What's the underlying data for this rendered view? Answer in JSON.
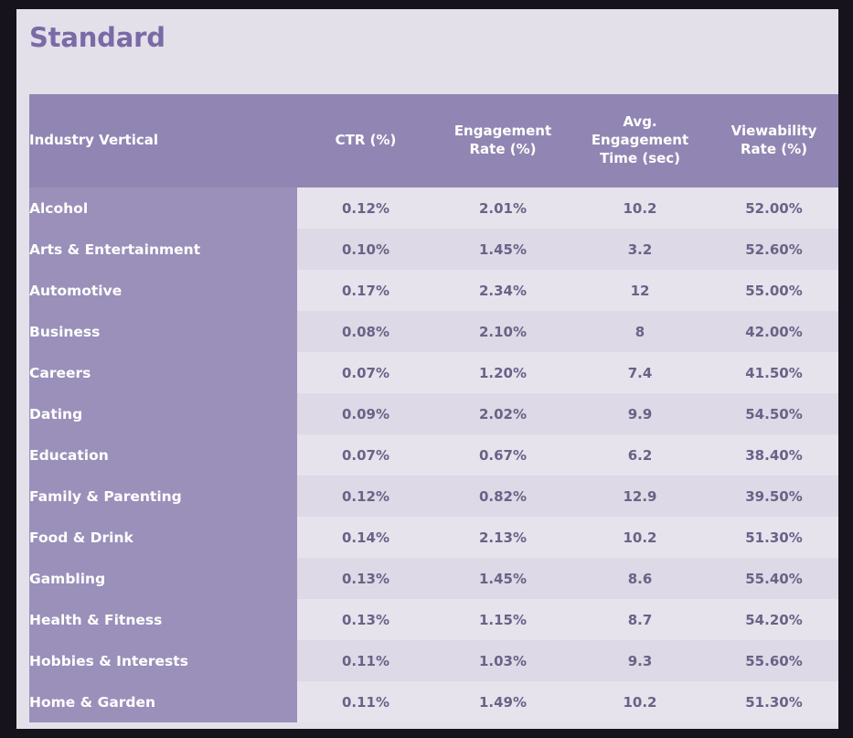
{
  "page": {
    "title": "Standard",
    "panel_color": "#E3E0EA",
    "frame_color": "#17131D",
    "title_color": "#7A6BA6",
    "header_color": "#9186B3",
    "first_column_color": "#9A90BA",
    "row_odd_color": "#E6E3ED",
    "row_even_color": "#DDD9E6",
    "data_text_color": "#6B6287"
  },
  "table": {
    "columns": [
      "Industry Vertical",
      "CTR (%)",
      "Engagement Rate (%)",
      "Avg. Engagement Time (sec)",
      "Viewability Rate (%)"
    ],
    "column_lines": {
      "ctr": [
        "CTR (%)"
      ],
      "engagement_rate": [
        "Engagement",
        "Rate (%)"
      ],
      "avg_engagement_time": [
        "Avg.",
        "Engagement",
        "Time (sec)"
      ],
      "viewability_rate": [
        "Viewability",
        "Rate (%)"
      ]
    },
    "rows": [
      {
        "vertical": "Alcohol",
        "ctr": "0.12%",
        "engagement_rate": "2.01%",
        "avg_engagement_time": "10.2",
        "viewability_rate": "52.00%"
      },
      {
        "vertical": "Arts & Entertainment",
        "ctr": "0.10%",
        "engagement_rate": "1.45%",
        "avg_engagement_time": "3.2",
        "viewability_rate": "52.60%"
      },
      {
        "vertical": "Automotive",
        "ctr": "0.17%",
        "engagement_rate": "2.34%",
        "avg_engagement_time": "12",
        "viewability_rate": "55.00%"
      },
      {
        "vertical": "Business",
        "ctr": "0.08%",
        "engagement_rate": "2.10%",
        "avg_engagement_time": "8",
        "viewability_rate": "42.00%"
      },
      {
        "vertical": "Careers",
        "ctr": "0.07%",
        "engagement_rate": "1.20%",
        "avg_engagement_time": "7.4",
        "viewability_rate": "41.50%"
      },
      {
        "vertical": "Dating",
        "ctr": "0.09%",
        "engagement_rate": "2.02%",
        "avg_engagement_time": "9.9",
        "viewability_rate": "54.50%"
      },
      {
        "vertical": "Education",
        "ctr": "0.07%",
        "engagement_rate": "0.67%",
        "avg_engagement_time": "6.2",
        "viewability_rate": "38.40%"
      },
      {
        "vertical": "Family & Parenting",
        "ctr": "0.12%",
        "engagement_rate": "0.82%",
        "avg_engagement_time": "12.9",
        "viewability_rate": "39.50%"
      },
      {
        "vertical": "Food & Drink",
        "ctr": "0.14%",
        "engagement_rate": "2.13%",
        "avg_engagement_time": "10.2",
        "viewability_rate": "51.30%"
      },
      {
        "vertical": "Gambling",
        "ctr": "0.13%",
        "engagement_rate": "1.45%",
        "avg_engagement_time": "8.6",
        "viewability_rate": "55.40%"
      },
      {
        "vertical": "Health & Fitness",
        "ctr": "0.13%",
        "engagement_rate": "1.15%",
        "avg_engagement_time": "8.7",
        "viewability_rate": "54.20%"
      },
      {
        "vertical": "Hobbies & Interests",
        "ctr": "0.11%",
        "engagement_rate": "1.03%",
        "avg_engagement_time": "9.3",
        "viewability_rate": "55.60%"
      },
      {
        "vertical": "Home & Garden",
        "ctr": "0.11%",
        "engagement_rate": "1.49%",
        "avg_engagement_time": "10.2",
        "viewability_rate": "51.30%"
      }
    ]
  },
  "chart_data": {
    "type": "table",
    "title": "Standard",
    "columns": [
      "Industry Vertical",
      "CTR (%)",
      "Engagement Rate (%)",
      "Avg. Engagement Time (sec)",
      "Viewability Rate (%)"
    ],
    "categories": [
      "Alcohol",
      "Arts & Entertainment",
      "Automotive",
      "Business",
      "Careers",
      "Dating",
      "Education",
      "Family & Parenting",
      "Food & Drink",
      "Gambling",
      "Health & Fitness",
      "Hobbies & Interests",
      "Home & Garden"
    ],
    "series": [
      {
        "name": "CTR (%)",
        "values": [
          0.12,
          0.1,
          0.17,
          0.08,
          0.07,
          0.09,
          0.07,
          0.12,
          0.14,
          0.13,
          0.13,
          0.11,
          0.11
        ]
      },
      {
        "name": "Engagement Rate (%)",
        "values": [
          2.01,
          1.45,
          2.34,
          2.1,
          1.2,
          2.02,
          0.67,
          0.82,
          2.13,
          1.45,
          1.15,
          1.03,
          1.49
        ]
      },
      {
        "name": "Avg. Engagement Time (sec)",
        "values": [
          10.2,
          3.2,
          12,
          8,
          7.4,
          9.9,
          6.2,
          12.9,
          10.2,
          8.6,
          8.7,
          9.3,
          10.2
        ]
      },
      {
        "name": "Viewability Rate (%)",
        "values": [
          52.0,
          52.6,
          55.0,
          42.0,
          41.5,
          54.5,
          38.4,
          39.5,
          51.3,
          55.4,
          54.2,
          55.6,
          51.3
        ]
      }
    ]
  }
}
